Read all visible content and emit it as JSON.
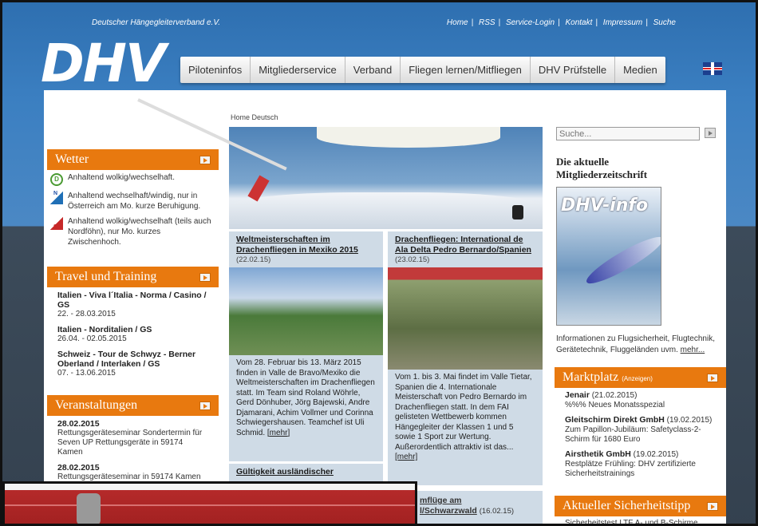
{
  "header": {
    "org_name": "Deutscher Hängegleiterverband e.V.",
    "logo_text": "DHV",
    "top_links": [
      "Home",
      "RSS",
      "Service-Login",
      "Kontakt",
      "Impressum",
      "Suche"
    ],
    "nav": [
      "Piloteninfos",
      "Mitgliederservice",
      "Verband",
      "Fliegen lernen/Mitfliegen",
      "DHV Prüfstelle",
      "Medien"
    ]
  },
  "breadcrumb": "Home Deutsch",
  "wetter": {
    "title": "Wetter",
    "items": [
      {
        "icon": "d-region-icon",
        "text": "Anhaltend wolkig/wechselhaft."
      },
      {
        "icon": "north-alps-icon",
        "text": "Anhaltend wechselhaft/windig, nur in Österreich am Mo. kurze Beruhigung."
      },
      {
        "icon": "south-alps-icon",
        "text": "Anhaltend wolkig/wechselhaft (teils auch Nordföhn), nur Mo. kurzes Zwischenhoch."
      }
    ]
  },
  "travel": {
    "title": "Travel und Training",
    "items": [
      {
        "name": "Italien - Viva l´Italia - Norma / Casino / GS",
        "date": "22. - 28.03.2015"
      },
      {
        "name": "Italien - Norditalien / GS",
        "date": "26.04. - 02.05.2015"
      },
      {
        "name": "Schweiz - Tour de Schwyz - Berner Oberland / Interlaken / GS",
        "date": "07. - 13.06.2015"
      }
    ]
  },
  "events": {
    "title": "Veranstaltungen",
    "items": [
      {
        "date": "28.02.2015",
        "text": "Rettungsgeräteseminar Sondertermin für Seven UP Rettungsgeräte in 59174 Kamen"
      },
      {
        "date": "28.02.2015",
        "text": "Rettungsgeräteseminar in 59174 Kamen"
      }
    ]
  },
  "news": {
    "n1": {
      "title": "Weltmeisterschaften im Drachenfliegen in Mexiko 2015",
      "date": "(22.02.15)",
      "text": "Vom 28. Februar bis 13. März 2015 finden in Valle de Bravo/Mexiko die Weltmeisterschaften im Drachenfliegen statt. Im Team sind Roland Wöhrle, Gerd Dönhuber, Jörg Bajewski, Andre Djamarani, Achim Vollmer und Corinna Schwiegershausen. Teamchef ist Uli Schmid.",
      "more": "[mehr]"
    },
    "n2": {
      "title": "Drachenfliegen: International de Ala Delta Pedro Bernardo/Spanien",
      "date": "(23.02.15)",
      "text": "Vom 1. bis 3. Mai findet im Valle Tietar, Spanien die 4. Internationale Meisterschaft von Pedro Bernardo im Drachenfliegen statt. In dem FAI gelisteten Wettbewerb kommen Hängegleiter der Klassen 1 und 5 sowie 1 Sport zur Wertung. Außerordentlich attraktiv ist das...",
      "more": "[mehr]"
    },
    "n3": {
      "title": "Gültigkeit ausländischer"
    },
    "n4": {
      "title": "mflüge am",
      "title2": "l/Schwarzwald",
      "date": "(16.02.15)"
    }
  },
  "search": {
    "placeholder": "Suche..."
  },
  "magazine": {
    "title": "Die aktuelle Mitgliederzeitschrift",
    "cover_title": "DHV-info",
    "desc": "Informationen zu Flugsicherheit, Flugtechnik, Gerätetechnik, Fluggeländen uvm.",
    "more": "mehr..."
  },
  "markt": {
    "title": "Marktplatz",
    "tag": "(Anzeigen)",
    "items": [
      {
        "name": "Jenair",
        "date": "(21.02.2015)",
        "text": "%%% Neues Monatsspezial"
      },
      {
        "name": "Gleitschirm Direkt GmbH",
        "date": "(19.02.2015)",
        "text": "Zum Papillon-Jubiläum: Safetyclass-2-Schirm für 1680 Euro"
      },
      {
        "name": "Airsthetik GmbH",
        "date": "(19.02.2015)",
        "text": "Restplätze Frühling: DHV zertifizierte Sicherheitstrainings"
      }
    ]
  },
  "tipp": {
    "title": "Aktueller Sicherheitstipp",
    "text": "Sicherheitstest LTF A- und B-Schirme."
  }
}
